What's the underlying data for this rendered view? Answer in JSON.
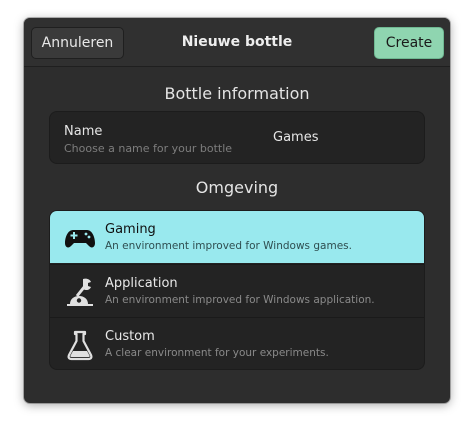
{
  "header": {
    "cancel_label": "Annuleren",
    "title": "Nieuwe bottle",
    "create_label": "Create"
  },
  "bottle_info": {
    "heading": "Bottle information",
    "name_label": "Name",
    "name_hint": "Choose a name for your bottle",
    "name_value": "Games"
  },
  "environment": {
    "heading": "Omgeving",
    "selected": "gaming",
    "options": [
      {
        "id": "gaming",
        "title": "Gaming",
        "subtitle": "An environment improved for Windows games.",
        "icon": "gamepad-icon"
      },
      {
        "id": "application",
        "title": "Application",
        "subtitle": "An environment improved for Windows application.",
        "icon": "wrench-desk-icon"
      },
      {
        "id": "custom",
        "title": "Custom",
        "subtitle": "A clear environment for your experiments.",
        "icon": "flask-icon"
      }
    ]
  },
  "colors": {
    "dialog_bg": "#2d2d2d",
    "create_button": "#8fd5b0",
    "selected_row": "#99e9ee"
  }
}
